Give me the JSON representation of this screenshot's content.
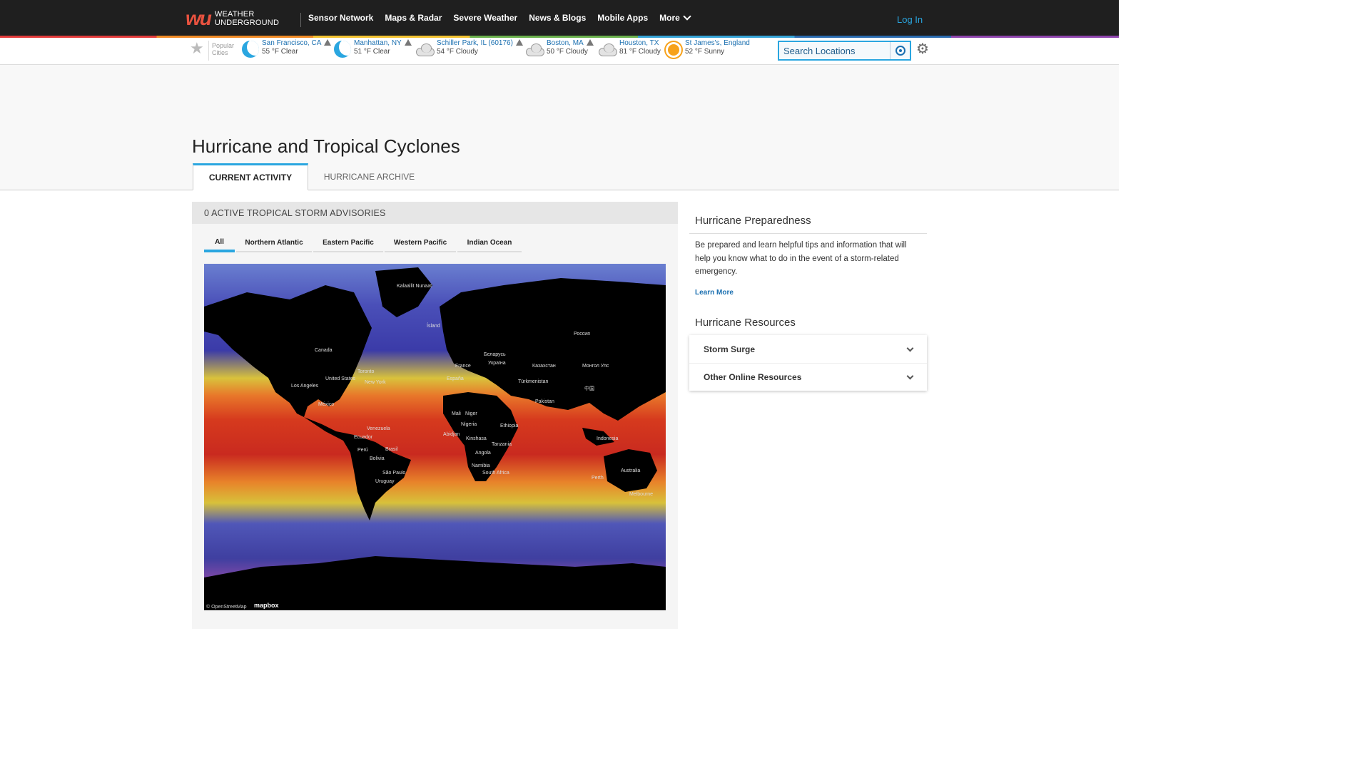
{
  "header": {
    "logo_mark": "wu",
    "logo_text_line1": "WEATHER",
    "logo_text_line2": "UNDERGROUND",
    "nav": [
      "Sensor Network",
      "Maps & Radar",
      "Severe Weather",
      "News & Blogs",
      "Mobile Apps"
    ],
    "more_label": "More",
    "login_label": "Log In"
  },
  "citybar": {
    "popular_line1": "Popular",
    "popular_line2": "Cities",
    "cities": [
      {
        "name": "San Francisco, CA",
        "temp": "55 °F Clear",
        "icon": "moon-icon",
        "alert": true
      },
      {
        "name": "Manhattan, NY",
        "temp": "51 °F Clear",
        "icon": "moon-icon",
        "alert": true
      },
      {
        "name": "Schiller Park, IL (60176)",
        "temp": "54 °F Cloudy",
        "icon": "cloud-icon",
        "alert": true
      },
      {
        "name": "Boston, MA",
        "temp": "50 °F Cloudy",
        "icon": "cloud-icon",
        "alert": true
      },
      {
        "name": "Houston, TX",
        "temp": "81 °F Cloudy",
        "icon": "cloud-icon",
        "alert": false
      },
      {
        "name": "St James's, England",
        "temp": "52 °F Sunny",
        "icon": "sun-icon",
        "alert": false
      }
    ],
    "search_placeholder": "Search Locations"
  },
  "page": {
    "title": "Hurricane and Tropical Cyclones",
    "tabs": [
      {
        "label": "CURRENT ACTIVITY",
        "active": true
      },
      {
        "label": "HURRICANE ARCHIVE",
        "active": false
      }
    ]
  },
  "advisories": {
    "heading": "0 ACTIVE TROPICAL STORM ADVISORIES",
    "basins": [
      {
        "label": "All",
        "active": true
      },
      {
        "label": "Northern Atlantic",
        "active": false
      },
      {
        "label": "Eastern Pacific",
        "active": false
      },
      {
        "label": "Western Pacific",
        "active": false
      },
      {
        "label": "Indian Ocean",
        "active": false
      }
    ],
    "map_labels": [
      "Kalaallit Nunaat",
      "Ísland",
      "Canada",
      "Россия",
      "United States",
      "Toronto",
      "New York",
      "Los Angeles",
      "México",
      "France",
      "España",
      "Беларусь",
      "Україна",
      "Казахстан",
      "Монгол Улс",
      "中国",
      "Türkmenistan",
      "Pakistan",
      "Mali",
      "Niger",
      "Nigeria",
      "Ethiopia",
      "Kinshasa",
      "Tanzania",
      "Angola",
      "Namibia",
      "South Africa",
      "Brasil",
      "Perú",
      "Bolivia",
      "São Paulo",
      "Uruguay",
      "Ecuador",
      "Venezuela",
      "Abidjan",
      "Australia",
      "Perth",
      "Melbourne",
      "Indonesia"
    ],
    "map_attribution": "© OpenStreetMap",
    "map_brand": "mapbox"
  },
  "sidebar": {
    "prep_title": "Hurricane Preparedness",
    "prep_text": "Be prepared and learn helpful tips and information that will help you know what to do in the event of a storm-related emergency.",
    "learn_more": "Learn More",
    "resources_title": "Hurricane Resources",
    "resources": [
      "Storm Surge",
      "Other Online Resources"
    ]
  },
  "colors": {
    "accent": "#2aa6e0",
    "link": "#1a6fb0",
    "topbar": "#1f1f1f"
  }
}
